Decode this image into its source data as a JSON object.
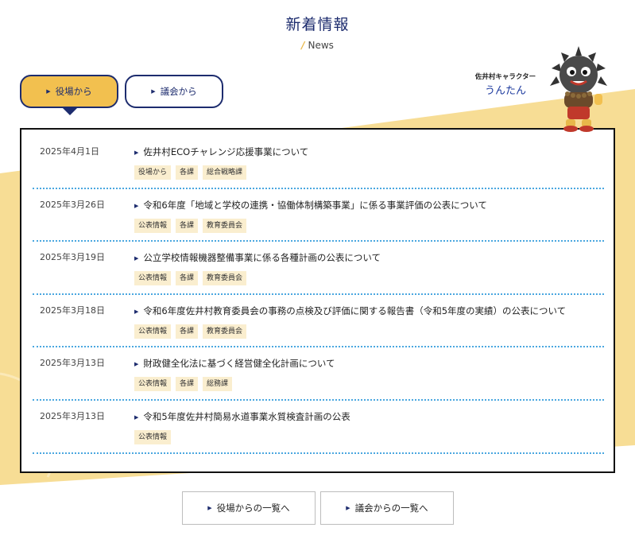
{
  "header": {
    "title": "新着情報",
    "subtitle": "News"
  },
  "tabs": [
    {
      "label": "役場から",
      "active": true
    },
    {
      "label": "議会から",
      "active": false
    }
  ],
  "mascot": {
    "caption": "佐井村キャラクター",
    "name": "うんたん"
  },
  "news": [
    {
      "date": "2025年4月1日",
      "title": "佐井村ECOチャレンジ応援事業について",
      "tags": [
        "役場から",
        "各課",
        "総合戦略課"
      ]
    },
    {
      "date": "2025年3月26日",
      "title": "令和6年度「地域と学校の連携・協働体制構築事業」に係る事業評価の公表について",
      "tags": [
        "公表情報",
        "各課",
        "教育委員会"
      ]
    },
    {
      "date": "2025年3月19日",
      "title": "公立学校情報機器整備事業に係る各種計画の公表について",
      "tags": [
        "公表情報",
        "各課",
        "教育委員会"
      ]
    },
    {
      "date": "2025年3月18日",
      "title": "令和6年度佐井村教育委員会の事務の点検及び評価に関する報告書（令和5年度の実績）の公表について",
      "tags": [
        "公表情報",
        "各課",
        "教育委員会"
      ]
    },
    {
      "date": "2025年3月13日",
      "title": "財政健全化法に基づく経営健全化計画について",
      "tags": [
        "公表情報",
        "各課",
        "総務課"
      ]
    },
    {
      "date": "2025年3月13日",
      "title": "令和5年度佐井村簡易水道事業水質検査計画の公表",
      "tags": [
        "公表情報"
      ]
    }
  ],
  "buttons": {
    "town_list": "役場からの一覧へ",
    "assembly_list": "議会からの一覧へ"
  },
  "colors": {
    "navy": "#1d2c6e",
    "accent_yellow": "#f2c04f",
    "background_band": "#f7dd95",
    "tag_bg": "#faeecf",
    "divider": "#4aa7e0"
  }
}
